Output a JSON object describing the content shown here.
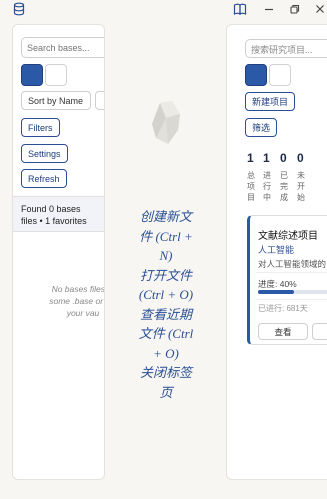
{
  "topbar": {
    "left_icon": "database-icon",
    "right_icon": "book-icon",
    "window_controls": [
      "minimize-icon",
      "restore-icon",
      "close-icon"
    ]
  },
  "left_panel": {
    "search_placeholder": "Search bases...",
    "sort_label": "Sort by Name",
    "filters_label": "Filters",
    "settings_label": "Settings",
    "refresh_label": "Refresh",
    "status_line1": "Found 0 bases",
    "status_line2": "files • 1 favorites",
    "empty_line1": "No bases files fo",
    "empty_line2": "some .base or .bc",
    "empty_line3": "your vau"
  },
  "center": {
    "logo_icon": "obsidian-logo-icon",
    "shortcuts": [
      "创建新文件 (Ctrl + N)",
      "打开文件 (Ctrl + O)",
      "查看近期文件 (Ctrl + O)",
      "关闭标签页"
    ],
    "shortcut_lines": [
      "创建新文",
      "件 (Ctrl +",
      "N)",
      "打开文件",
      "(Ctrl + O)",
      "查看近期",
      "文件 (Ctrl",
      "+ O)",
      "关闭标签",
      "页"
    ]
  },
  "right_panel": {
    "search_placeholder": "搜索研究项目...",
    "new_project_label": "新建项目",
    "filter_label": "筛选",
    "stats": [
      {
        "value": "1",
        "label": "总项目"
      },
      {
        "value": "1",
        "label": "进行中"
      },
      {
        "value": "0",
        "label": "已完成"
      },
      {
        "value": "0",
        "label": "未开始"
      }
    ],
    "card": {
      "title": "文献综述项目",
      "tag": "人工智能",
      "description": "对人工智能领域的",
      "progress_label": "进度: 40%",
      "progress": 0.4,
      "elapsed": "已进行: 681天",
      "view_label": "查看"
    }
  },
  "colors": {
    "accent": "#2c58a8",
    "background": "#f7f6f2",
    "link": "#2a4f96"
  }
}
